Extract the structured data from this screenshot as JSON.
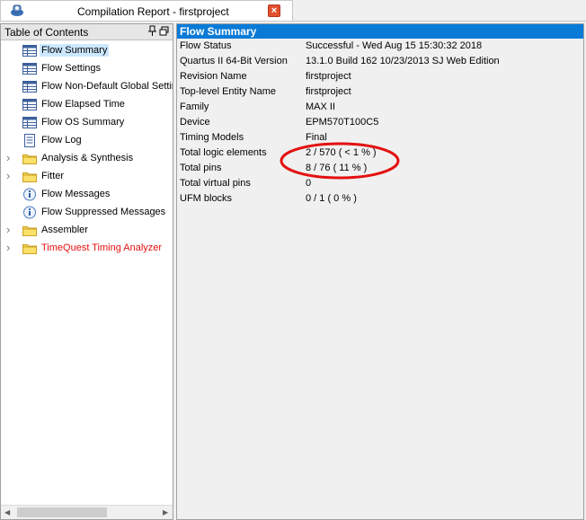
{
  "tab": {
    "title": "Compilation Report - firstproject",
    "close_symbol": "×"
  },
  "toc": {
    "title": "Table of Contents",
    "items": [
      {
        "label": "Flow Summary",
        "icon": "table-icon",
        "expandable": false,
        "selected": true,
        "red": false
      },
      {
        "label": "Flow Settings",
        "icon": "table-icon",
        "expandable": false,
        "selected": false,
        "red": false
      },
      {
        "label": "Flow Non-Default Global Settings",
        "icon": "table-icon",
        "expandable": false,
        "selected": false,
        "red": false
      },
      {
        "label": "Flow Elapsed Time",
        "icon": "table-icon",
        "expandable": false,
        "selected": false,
        "red": false
      },
      {
        "label": "Flow OS Summary",
        "icon": "table-icon",
        "expandable": false,
        "selected": false,
        "red": false
      },
      {
        "label": "Flow Log",
        "icon": "log-icon",
        "expandable": false,
        "selected": false,
        "red": false
      },
      {
        "label": "Analysis & Synthesis",
        "icon": "folder-icon",
        "expandable": true,
        "selected": false,
        "red": false
      },
      {
        "label": "Fitter",
        "icon": "folder-icon",
        "expandable": true,
        "selected": false,
        "red": false
      },
      {
        "label": "Flow Messages",
        "icon": "info-icon",
        "expandable": false,
        "selected": false,
        "red": false
      },
      {
        "label": "Flow Suppressed Messages",
        "icon": "info-icon",
        "expandable": false,
        "selected": false,
        "red": false
      },
      {
        "label": "Assembler",
        "icon": "folder-icon",
        "expandable": true,
        "selected": false,
        "red": false
      },
      {
        "label": "TimeQuest Timing Analyzer",
        "icon": "folder-icon",
        "expandable": true,
        "selected": false,
        "red": true
      }
    ]
  },
  "report": {
    "title": "Flow Summary",
    "rows": [
      {
        "key": "Flow Status",
        "value": "Successful - Wed Aug 15 15:30:32 2018"
      },
      {
        "key": "Quartus II 64-Bit Version",
        "value": "13.1.0 Build 162 10/23/2013 SJ Web Edition"
      },
      {
        "key": "Revision Name",
        "value": "firstproject"
      },
      {
        "key": "Top-level Entity Name",
        "value": "firstproject"
      },
      {
        "key": "Family",
        "value": "MAX II"
      },
      {
        "key": "Device",
        "value": "EPM570T100C5"
      },
      {
        "key": "Timing Models",
        "value": "Final"
      },
      {
        "key": "Total logic elements",
        "value": "2 / 570 ( < 1 % )"
      },
      {
        "key": "Total pins",
        "value": "8 / 76 ( 11 % )"
      },
      {
        "key": "Total virtual pins",
        "value": "0"
      },
      {
        "key": "UFM blocks",
        "value": "0 / 1 ( 0 % )"
      }
    ]
  },
  "colors": {
    "header_blue": "#0a7ad7",
    "annotation_red": "#e41010",
    "selected_bg": "#cce8ff"
  }
}
